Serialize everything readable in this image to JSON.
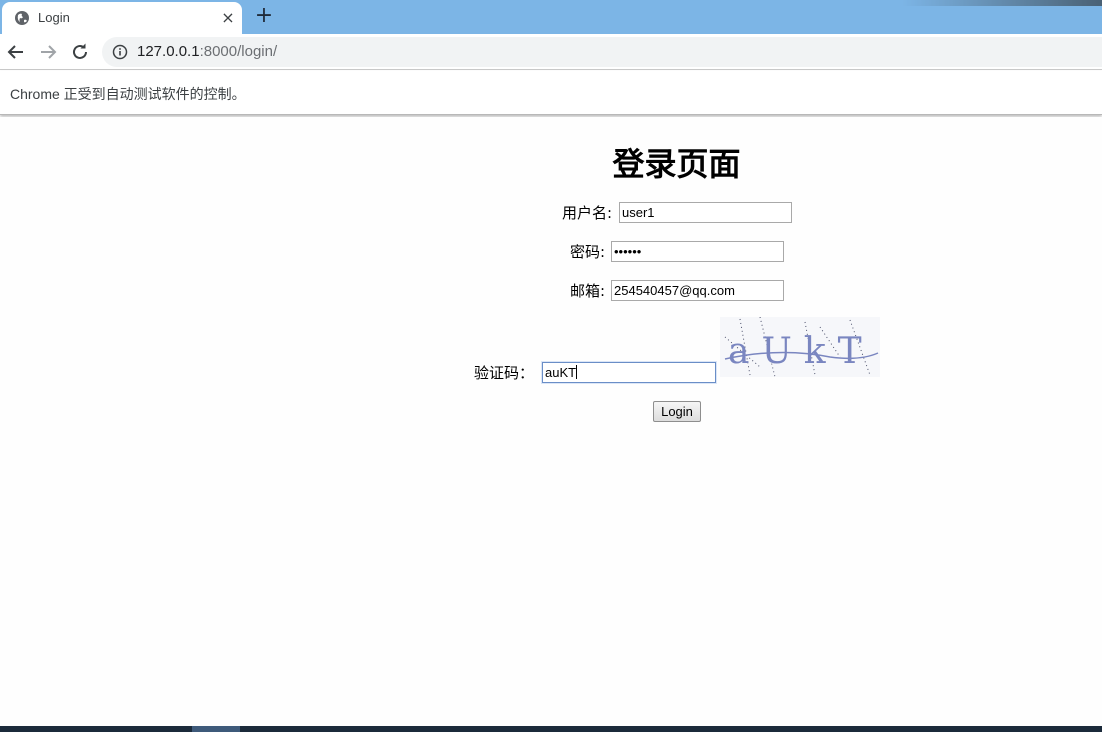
{
  "browser": {
    "tab": {
      "title": "Login",
      "close_glyph": "×",
      "favicon": "globe-icon"
    },
    "new_tab_glyph": "+",
    "url": {
      "host": "127.0.0.1",
      "rest": ":8000/login/"
    },
    "infobar": {
      "message": "Chrome 正受到自动测试软件的控制。"
    }
  },
  "page": {
    "heading": "登录页面",
    "form": {
      "username": {
        "label": "用户名:",
        "value": "user1"
      },
      "password": {
        "label": "密码:",
        "value": "••••••"
      },
      "email": {
        "label": "邮箱:",
        "value": "254540457@qq.com"
      },
      "captcha": {
        "label": "验证码：",
        "value": "auKT",
        "image_text": "aUkT"
      },
      "submit_label": "Login"
    }
  },
  "colors": {
    "tabstrip": "#7cb5e6",
    "captcha_text": "#7a86c0"
  }
}
